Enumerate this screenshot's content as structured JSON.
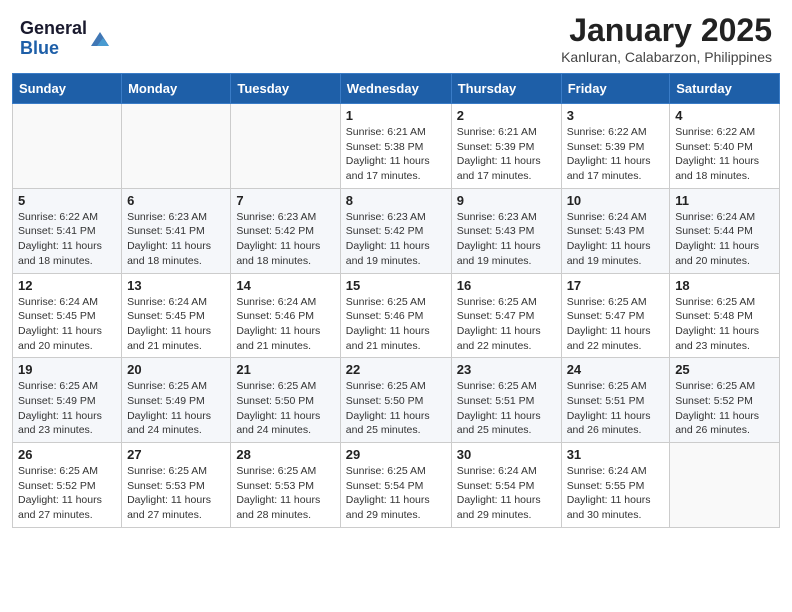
{
  "header": {
    "logo_general": "General",
    "logo_blue": "Blue",
    "month_title": "January 2025",
    "subtitle": "Kanluran, Calabarzon, Philippines"
  },
  "weekdays": [
    "Sunday",
    "Monday",
    "Tuesday",
    "Wednesday",
    "Thursday",
    "Friday",
    "Saturday"
  ],
  "weeks": [
    [
      {
        "day": "",
        "sunrise": "",
        "sunset": "",
        "daylight": ""
      },
      {
        "day": "",
        "sunrise": "",
        "sunset": "",
        "daylight": ""
      },
      {
        "day": "",
        "sunrise": "",
        "sunset": "",
        "daylight": ""
      },
      {
        "day": "1",
        "sunrise": "Sunrise: 6:21 AM",
        "sunset": "Sunset: 5:38 PM",
        "daylight": "Daylight: 11 hours and 17 minutes."
      },
      {
        "day": "2",
        "sunrise": "Sunrise: 6:21 AM",
        "sunset": "Sunset: 5:39 PM",
        "daylight": "Daylight: 11 hours and 17 minutes."
      },
      {
        "day": "3",
        "sunrise": "Sunrise: 6:22 AM",
        "sunset": "Sunset: 5:39 PM",
        "daylight": "Daylight: 11 hours and 17 minutes."
      },
      {
        "day": "4",
        "sunrise": "Sunrise: 6:22 AM",
        "sunset": "Sunset: 5:40 PM",
        "daylight": "Daylight: 11 hours and 18 minutes."
      }
    ],
    [
      {
        "day": "5",
        "sunrise": "Sunrise: 6:22 AM",
        "sunset": "Sunset: 5:41 PM",
        "daylight": "Daylight: 11 hours and 18 minutes."
      },
      {
        "day": "6",
        "sunrise": "Sunrise: 6:23 AM",
        "sunset": "Sunset: 5:41 PM",
        "daylight": "Daylight: 11 hours and 18 minutes."
      },
      {
        "day": "7",
        "sunrise": "Sunrise: 6:23 AM",
        "sunset": "Sunset: 5:42 PM",
        "daylight": "Daylight: 11 hours and 18 minutes."
      },
      {
        "day": "8",
        "sunrise": "Sunrise: 6:23 AM",
        "sunset": "Sunset: 5:42 PM",
        "daylight": "Daylight: 11 hours and 19 minutes."
      },
      {
        "day": "9",
        "sunrise": "Sunrise: 6:23 AM",
        "sunset": "Sunset: 5:43 PM",
        "daylight": "Daylight: 11 hours and 19 minutes."
      },
      {
        "day": "10",
        "sunrise": "Sunrise: 6:24 AM",
        "sunset": "Sunset: 5:43 PM",
        "daylight": "Daylight: 11 hours and 19 minutes."
      },
      {
        "day": "11",
        "sunrise": "Sunrise: 6:24 AM",
        "sunset": "Sunset: 5:44 PM",
        "daylight": "Daylight: 11 hours and 20 minutes."
      }
    ],
    [
      {
        "day": "12",
        "sunrise": "Sunrise: 6:24 AM",
        "sunset": "Sunset: 5:45 PM",
        "daylight": "Daylight: 11 hours and 20 minutes."
      },
      {
        "day": "13",
        "sunrise": "Sunrise: 6:24 AM",
        "sunset": "Sunset: 5:45 PM",
        "daylight": "Daylight: 11 hours and 21 minutes."
      },
      {
        "day": "14",
        "sunrise": "Sunrise: 6:24 AM",
        "sunset": "Sunset: 5:46 PM",
        "daylight": "Daylight: 11 hours and 21 minutes."
      },
      {
        "day": "15",
        "sunrise": "Sunrise: 6:25 AM",
        "sunset": "Sunset: 5:46 PM",
        "daylight": "Daylight: 11 hours and 21 minutes."
      },
      {
        "day": "16",
        "sunrise": "Sunrise: 6:25 AM",
        "sunset": "Sunset: 5:47 PM",
        "daylight": "Daylight: 11 hours and 22 minutes."
      },
      {
        "day": "17",
        "sunrise": "Sunrise: 6:25 AM",
        "sunset": "Sunset: 5:47 PM",
        "daylight": "Daylight: 11 hours and 22 minutes."
      },
      {
        "day": "18",
        "sunrise": "Sunrise: 6:25 AM",
        "sunset": "Sunset: 5:48 PM",
        "daylight": "Daylight: 11 hours and 23 minutes."
      }
    ],
    [
      {
        "day": "19",
        "sunrise": "Sunrise: 6:25 AM",
        "sunset": "Sunset: 5:49 PM",
        "daylight": "Daylight: 11 hours and 23 minutes."
      },
      {
        "day": "20",
        "sunrise": "Sunrise: 6:25 AM",
        "sunset": "Sunset: 5:49 PM",
        "daylight": "Daylight: 11 hours and 24 minutes."
      },
      {
        "day": "21",
        "sunrise": "Sunrise: 6:25 AM",
        "sunset": "Sunset: 5:50 PM",
        "daylight": "Daylight: 11 hours and 24 minutes."
      },
      {
        "day": "22",
        "sunrise": "Sunrise: 6:25 AM",
        "sunset": "Sunset: 5:50 PM",
        "daylight": "Daylight: 11 hours and 25 minutes."
      },
      {
        "day": "23",
        "sunrise": "Sunrise: 6:25 AM",
        "sunset": "Sunset: 5:51 PM",
        "daylight": "Daylight: 11 hours and 25 minutes."
      },
      {
        "day": "24",
        "sunrise": "Sunrise: 6:25 AM",
        "sunset": "Sunset: 5:51 PM",
        "daylight": "Daylight: 11 hours and 26 minutes."
      },
      {
        "day": "25",
        "sunrise": "Sunrise: 6:25 AM",
        "sunset": "Sunset: 5:52 PM",
        "daylight": "Daylight: 11 hours and 26 minutes."
      }
    ],
    [
      {
        "day": "26",
        "sunrise": "Sunrise: 6:25 AM",
        "sunset": "Sunset: 5:52 PM",
        "daylight": "Daylight: 11 hours and 27 minutes."
      },
      {
        "day": "27",
        "sunrise": "Sunrise: 6:25 AM",
        "sunset": "Sunset: 5:53 PM",
        "daylight": "Daylight: 11 hours and 27 minutes."
      },
      {
        "day": "28",
        "sunrise": "Sunrise: 6:25 AM",
        "sunset": "Sunset: 5:53 PM",
        "daylight": "Daylight: 11 hours and 28 minutes."
      },
      {
        "day": "29",
        "sunrise": "Sunrise: 6:25 AM",
        "sunset": "Sunset: 5:54 PM",
        "daylight": "Daylight: 11 hours and 29 minutes."
      },
      {
        "day": "30",
        "sunrise": "Sunrise: 6:24 AM",
        "sunset": "Sunset: 5:54 PM",
        "daylight": "Daylight: 11 hours and 29 minutes."
      },
      {
        "day": "31",
        "sunrise": "Sunrise: 6:24 AM",
        "sunset": "Sunset: 5:55 PM",
        "daylight": "Daylight: 11 hours and 30 minutes."
      },
      {
        "day": "",
        "sunrise": "",
        "sunset": "",
        "daylight": ""
      }
    ]
  ]
}
